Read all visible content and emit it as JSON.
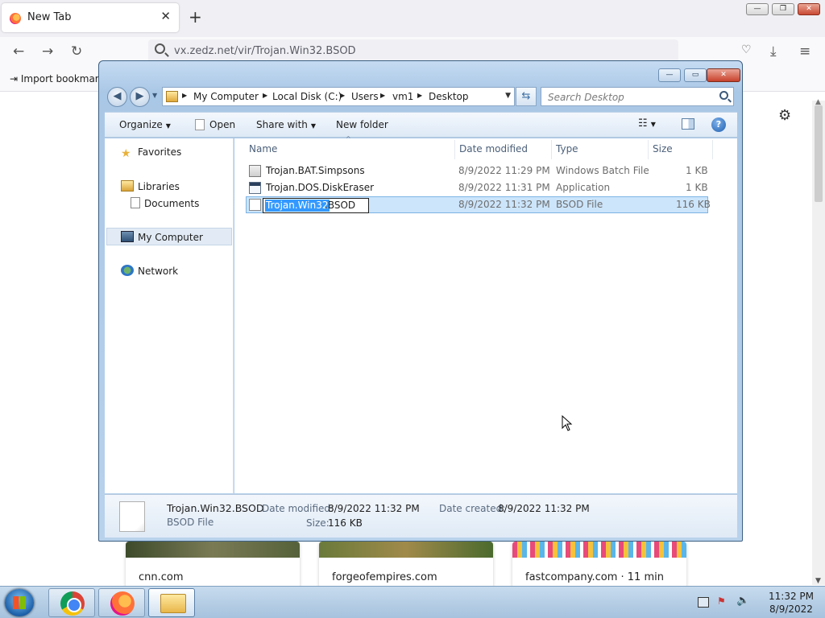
{
  "browser": {
    "tab_title": "New Tab",
    "tab_close": "✕",
    "new_tab": "+",
    "url": "vx.zedz.net/vir/Trojan.Win32.BSOD",
    "bookmark_import": "Import bookmarks...",
    "window_controls": {
      "minimize": "—",
      "maximize": "❐",
      "close": "✕"
    },
    "tiles": [
      {
        "label": "cnn.com"
      },
      {
        "label": "forgeofempires.com"
      },
      {
        "label": "fastcompany.com · 11 min"
      }
    ]
  },
  "explorer": {
    "window_controls": {
      "minimize": "—",
      "maximize": "▭",
      "close": "✕"
    },
    "breadcrumbs": [
      "My Computer",
      "Local Disk (C:)",
      "Users",
      "vm1",
      "Desktop"
    ],
    "search_placeholder": "Search Desktop",
    "commands": {
      "organize": "Organize",
      "open": "Open",
      "share_with": "Share with",
      "new_folder": "New folder"
    },
    "nav_pane": {
      "favorites": "Favorites",
      "libraries": "Libraries",
      "documents": "Documents",
      "my_computer": "My Computer",
      "network": "Network"
    },
    "columns": {
      "name": "Name",
      "date_modified": "Date modified",
      "type": "Type",
      "size": "Size"
    },
    "files": [
      {
        "name": "Trojan.BAT.Simpsons",
        "date": "8/9/2022 11:29 PM",
        "type": "Windows Batch File",
        "size": "1 KB"
      },
      {
        "name": "Trojan.DOS.DiskEraser",
        "date": "8/9/2022 11:31 PM",
        "type": "Application",
        "size": "1 KB"
      },
      {
        "name": "Trojan.Win32.BSOD",
        "date": "8/9/2022 11:32 PM",
        "type": "BSOD File",
        "size": "116 KB"
      }
    ],
    "rename": {
      "selected": "Trojan.Win32",
      "rest": ".BSOD"
    },
    "details": {
      "filename": "Trojan.Win32.BSOD",
      "filetype": "BSOD File",
      "modified_label": "Date modified:",
      "modified_value": "8/9/2022 11:32 PM",
      "created_label": "Date created:",
      "created_value": "8/9/2022 11:32 PM",
      "size_label": "Size:",
      "size_value": "116 KB"
    }
  },
  "taskbar": {
    "time": "11:32 PM",
    "date": "8/9/2022"
  }
}
